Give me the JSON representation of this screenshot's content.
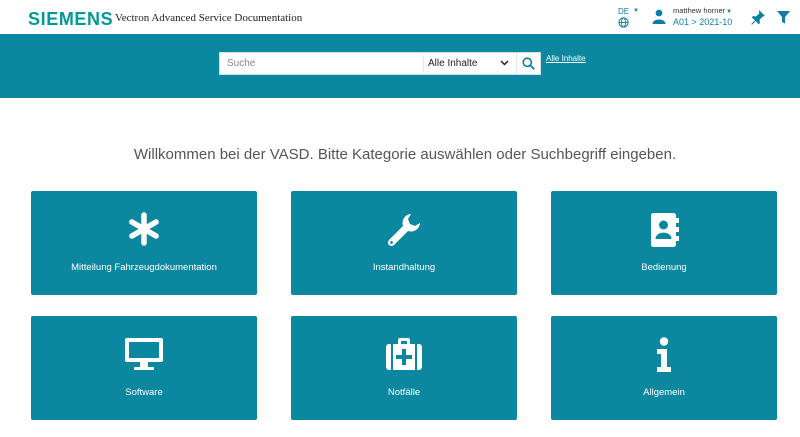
{
  "header": {
    "logo_text": "SIEMENS",
    "app_title": "Vectron Advanced Service Documentation",
    "language": "DE",
    "user_name": "matthew horner",
    "user_context": "A01 > 2021-10"
  },
  "search": {
    "placeholder": "Suche",
    "scope_selected": "Alle Inhalte",
    "all_content_link": "Alle Inhalte"
  },
  "welcome_text": "Willkommen bei der VASD. Bitte Kategorie auswählen oder Suchbegriff eingeben.",
  "tiles": [
    {
      "label": "Mitteilung Fahrzeugdokumentation",
      "icon": "asterisk-icon"
    },
    {
      "label": "Instandhaltung",
      "icon": "wrench-icon"
    },
    {
      "label": "Bedienung",
      "icon": "address-book-icon"
    },
    {
      "label": "Software",
      "icon": "monitor-icon"
    },
    {
      "label": "Notfälle",
      "icon": "medkit-icon"
    },
    {
      "label": "Allgemein",
      "icon": "info-icon"
    }
  ],
  "colors": {
    "brand": "#009999",
    "primary": "#0b879f",
    "link": "#0b7fa3"
  }
}
